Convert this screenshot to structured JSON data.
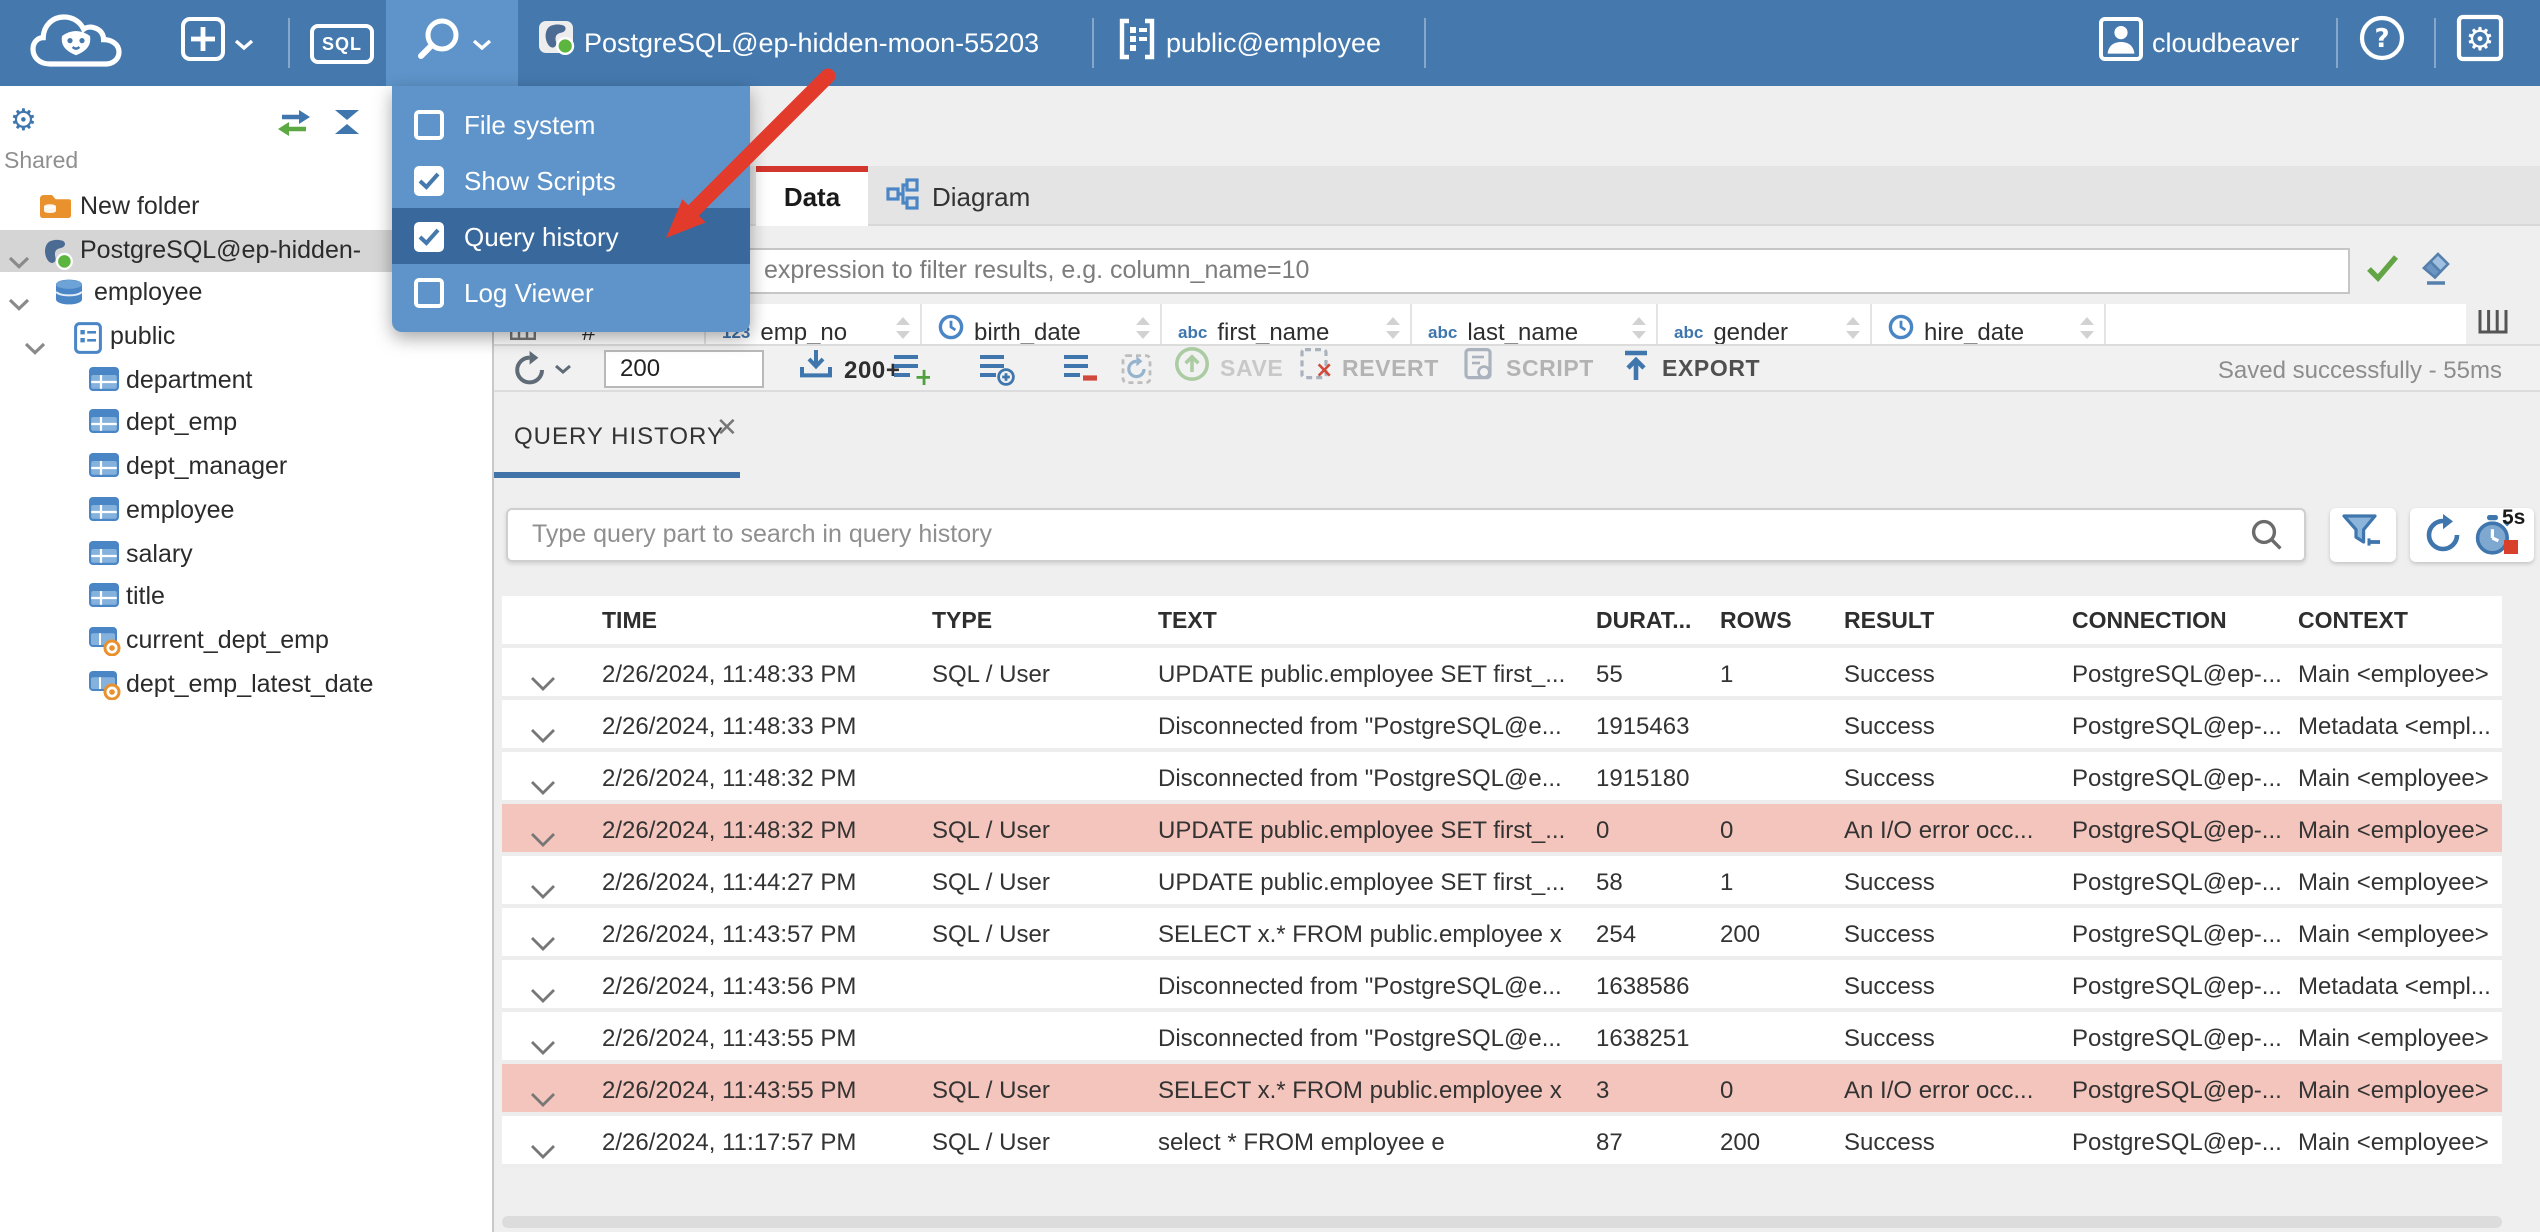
{
  "topbar": {
    "sql_button": "SQL",
    "connection_name": "PostgreSQL@ep-hidden-moon-55203",
    "schema_selector": "public@employee",
    "username": "cloudbeaver",
    "icons": [
      "cloudbeaver-logo",
      "new-object",
      "sql-editor",
      "tools",
      "postgres-driver",
      "schema",
      "user-avatar",
      "help",
      "settings"
    ]
  },
  "tools_menu": {
    "items": [
      {
        "label": "File system",
        "checked": false,
        "highlighted": false
      },
      {
        "label": "Show Scripts",
        "checked": true,
        "highlighted": false
      },
      {
        "label": "Query history",
        "checked": true,
        "highlighted": true
      },
      {
        "label": "Log Viewer",
        "checked": false,
        "highlighted": false
      }
    ]
  },
  "sidebar": {
    "section_label": "Shared",
    "tree": [
      {
        "label": "New folder",
        "icon": "folder",
        "level": 0,
        "expanded": false,
        "selected": false
      },
      {
        "label": "PostgreSQL@ep-hidden-",
        "icon": "postgres",
        "level": 0,
        "expanded": true,
        "selected": true
      },
      {
        "label": "employee",
        "icon": "database",
        "level": 1,
        "expanded": true,
        "selected": false
      },
      {
        "label": "public",
        "icon": "schema",
        "level": 2,
        "expanded": true,
        "selected": false
      },
      {
        "label": "department",
        "icon": "table",
        "level": 3,
        "expanded": false,
        "selected": false
      },
      {
        "label": "dept_emp",
        "icon": "table",
        "level": 3,
        "expanded": false,
        "selected": false
      },
      {
        "label": "dept_manager",
        "icon": "table",
        "level": 3,
        "expanded": false,
        "selected": false
      },
      {
        "label": "employee",
        "icon": "table",
        "level": 3,
        "expanded": false,
        "selected": false
      },
      {
        "label": "salary",
        "icon": "table",
        "level": 3,
        "expanded": false,
        "selected": false
      },
      {
        "label": "title",
        "icon": "table",
        "level": 3,
        "expanded": false,
        "selected": false
      },
      {
        "label": "current_dept_emp",
        "icon": "view",
        "level": 3,
        "expanded": false,
        "selected": false
      },
      {
        "label": "dept_emp_latest_date",
        "icon": "view",
        "level": 3,
        "expanded": false,
        "selected": false
      }
    ]
  },
  "object_page": {
    "tabs": {
      "data": "Data",
      "diagram": "Diagram"
    },
    "filter_placeholder": "expression to filter results, e.g. column_name=10",
    "grid_columns": [
      {
        "prefix": "corner",
        "label": "#"
      },
      {
        "prefix": "123",
        "label": "emp_no"
      },
      {
        "prefix": "clock",
        "label": "birth_date"
      },
      {
        "prefix": "abc",
        "label": "first_name"
      },
      {
        "prefix": "abc",
        "label": "last_name"
      },
      {
        "prefix": "abc",
        "label": "gender"
      },
      {
        "prefix": "clock",
        "label": "hire_date"
      }
    ],
    "toolbar": {
      "row_limit_value": "200",
      "fetch_more_label": "200+",
      "save_label": "SAVE",
      "revert_label": "REVERT",
      "script_label": "SCRIPT",
      "export_label": "EXPORT",
      "status_message": "Saved successfully - 55ms"
    }
  },
  "query_history": {
    "tab_title": "QUERY HISTORY",
    "search_placeholder": "Type query part to search in query history",
    "auto_refresh_interval": "5s",
    "columns": [
      "TIME",
      "TYPE",
      "TEXT",
      "DURAT...",
      "ROWS",
      "RESULT",
      "CONNECTION",
      "CONTEXT"
    ],
    "rows": [
      {
        "time": "2/26/2024, 11:48:33 PM",
        "type": "SQL / User",
        "text": "UPDATE public.employee SET first_...",
        "duration": "55",
        "rows": "1",
        "result": "Success",
        "connection": "PostgreSQL@ep-...",
        "context": "Main <employee>",
        "error": false
      },
      {
        "time": "2/26/2024, 11:48:33 PM",
        "type": "",
        "text": "Disconnected from \"PostgreSQL@e...",
        "duration": "1915463",
        "rows": "",
        "result": "Success",
        "connection": "PostgreSQL@ep-...",
        "context": "Metadata <empl...",
        "error": false
      },
      {
        "time": "2/26/2024, 11:48:32 PM",
        "type": "",
        "text": "Disconnected from \"PostgreSQL@e...",
        "duration": "1915180",
        "rows": "",
        "result": "Success",
        "connection": "PostgreSQL@ep-...",
        "context": "Main <employee>",
        "error": false
      },
      {
        "time": "2/26/2024, 11:48:32 PM",
        "type": "SQL / User",
        "text": "UPDATE public.employee SET first_...",
        "duration": "0",
        "rows": "0",
        "result": "An I/O error occ...",
        "connection": "PostgreSQL@ep-...",
        "context": "Main <employee>",
        "error": true
      },
      {
        "time": "2/26/2024, 11:44:27 PM",
        "type": "SQL / User",
        "text": "UPDATE public.employee SET first_...",
        "duration": "58",
        "rows": "1",
        "result": "Success",
        "connection": "PostgreSQL@ep-...",
        "context": "Main <employee>",
        "error": false
      },
      {
        "time": "2/26/2024, 11:43:57 PM",
        "type": "SQL / User",
        "text": "SELECT x.* FROM public.employee x",
        "duration": "254",
        "rows": "200",
        "result": "Success",
        "connection": "PostgreSQL@ep-...",
        "context": "Main <employee>",
        "error": false
      },
      {
        "time": "2/26/2024, 11:43:56 PM",
        "type": "",
        "text": "Disconnected from \"PostgreSQL@e...",
        "duration": "1638586",
        "rows": "",
        "result": "Success",
        "connection": "PostgreSQL@ep-...",
        "context": "Metadata <empl...",
        "error": false
      },
      {
        "time": "2/26/2024, 11:43:55 PM",
        "type": "",
        "text": "Disconnected from \"PostgreSQL@e...",
        "duration": "1638251",
        "rows": "",
        "result": "Success",
        "connection": "PostgreSQL@ep-...",
        "context": "Main <employee>",
        "error": false
      },
      {
        "time": "2/26/2024, 11:43:55 PM",
        "type": "SQL / User",
        "text": "SELECT x.* FROM public.employee x",
        "duration": "3",
        "rows": "0",
        "result": "An I/O error occ...",
        "connection": "PostgreSQL@ep-...",
        "context": "Main <employee>",
        "error": true
      },
      {
        "time": "2/26/2024, 11:17:57 PM",
        "type": "SQL / User",
        "text": "select * FROM employee e",
        "duration": "87",
        "rows": "200",
        "result": "Success",
        "connection": "PostgreSQL@ep-...",
        "context": "Main <employee>",
        "error": false
      }
    ]
  },
  "colors": {
    "topbar": "#4579ae",
    "menu_bg": "#5e94c9",
    "menu_highlight": "#38689c",
    "accent_red": "#d3362d",
    "arrow_red": "#e23b2c",
    "error_row_bg": "#f4c5bc",
    "accent_blue": "#3e76ad"
  }
}
